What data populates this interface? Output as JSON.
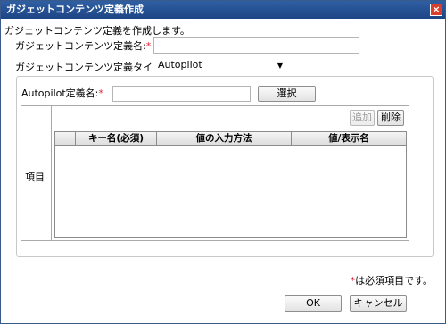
{
  "window": {
    "title": "ガジェットコンテンツ定義作成",
    "close_glyph": "×"
  },
  "intro": "ガジェットコンテンツ定義を作成します。",
  "form": {
    "name_label": "ガジェットコンテンツ定義名:",
    "name_value": "",
    "type_label": "ガジェットコンテンツ定義タイプ:",
    "type_value": "Autopilot",
    "required_mark": "*"
  },
  "panel": {
    "autopilot_label": "Autopilot定義名:",
    "autopilot_value": "",
    "select_button": "選択",
    "items_label": "項目",
    "add_button": "追加",
    "delete_button": "削除",
    "table": {
      "columns": [
        "キー名(必須)",
        "値の入力方法",
        "値/表示名"
      ],
      "rows": []
    }
  },
  "footnote": "は必須項目です。",
  "buttons": {
    "ok": "OK",
    "cancel": "キャンセル"
  },
  "colors": {
    "titlebar": "#1d4585",
    "required": "#e0233a",
    "close": "#d9402b"
  }
}
